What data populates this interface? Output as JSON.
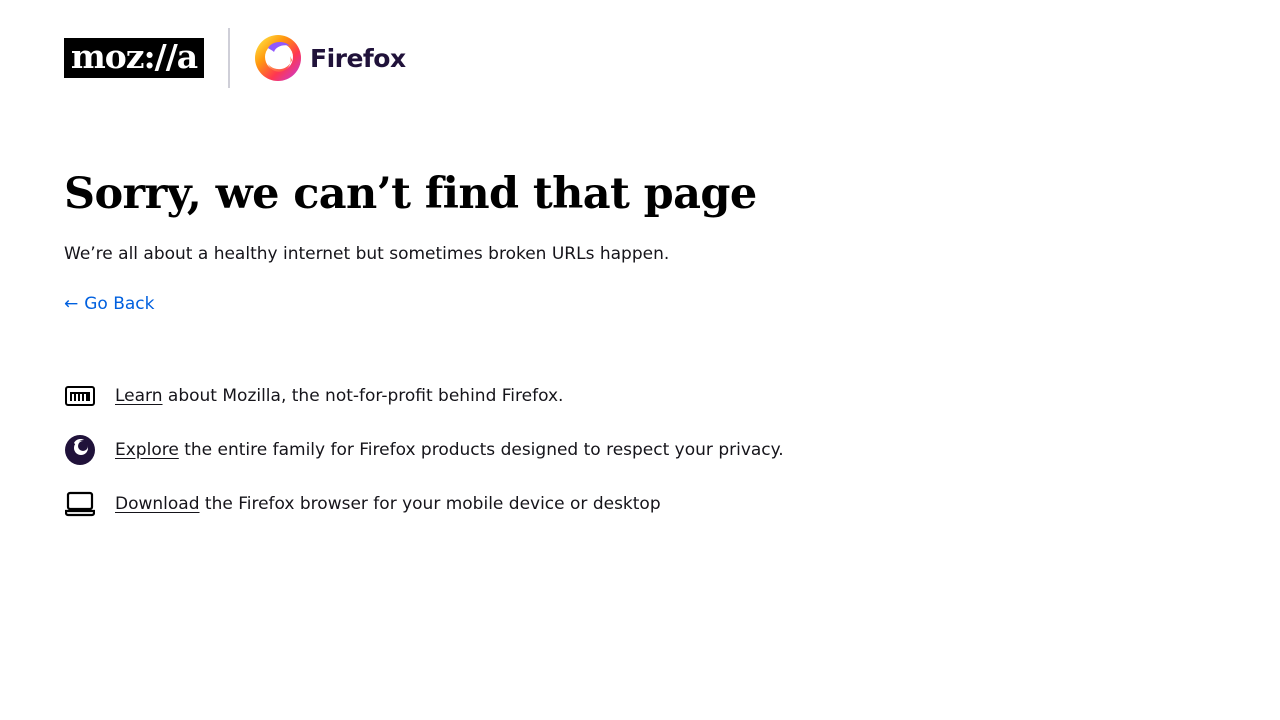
{
  "header": {
    "mozilla_logo_text": "moz://a",
    "firefox_wordmark": "Firefox"
  },
  "main": {
    "title": "Sorry, we can’t find that page",
    "subtitle": "We’re all about a healthy internet but sometimes broken URLs happen.",
    "back_link": {
      "arrow": "←",
      "label": "Go Back"
    }
  },
  "info_items": [
    {
      "icon": "mozilla-m-icon",
      "link_text": "Learn",
      "text": " about Mozilla, the not-for-profit behind Firefox."
    },
    {
      "icon": "firefox-browser-icon",
      "link_text": "Explore",
      "text": " the entire family for Firefox products designed to respect your privacy."
    },
    {
      "icon": "laptop-icon",
      "link_text": "Download",
      "text": " the Firefox browser for your mobile device or desktop"
    }
  ],
  "colors": {
    "link_blue": "#0060df",
    "text": "#15141a",
    "divider": "#cfcfd8",
    "firefox_dark": "#20123a"
  }
}
